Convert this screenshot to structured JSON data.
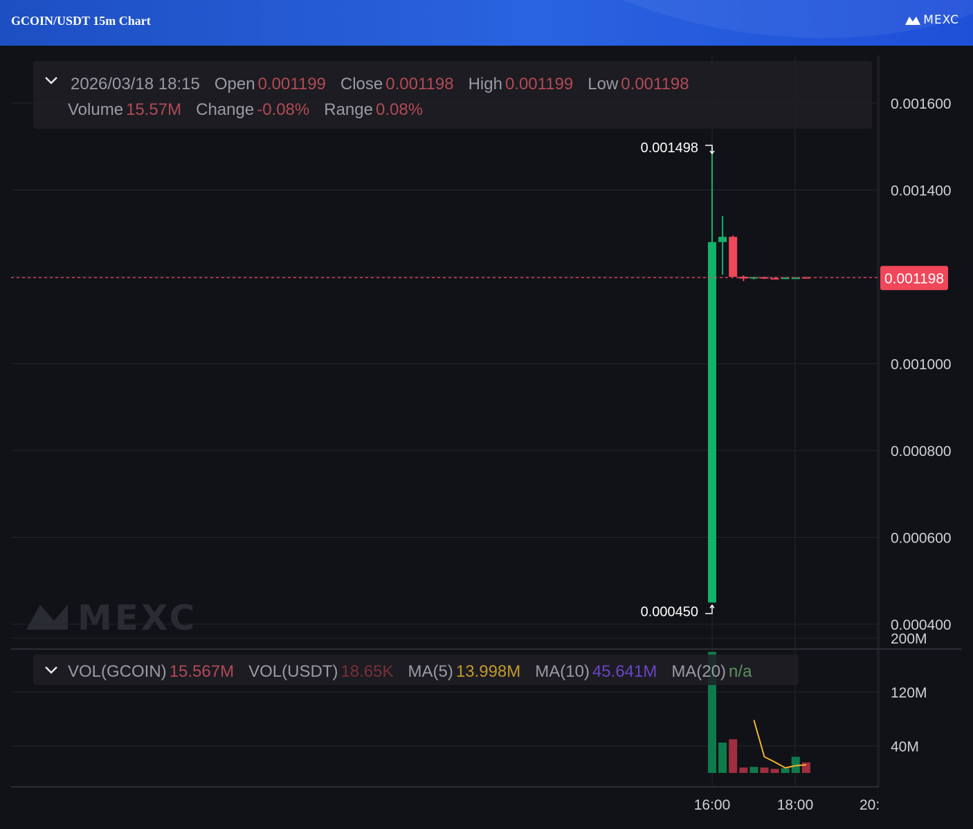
{
  "header": {
    "title": "GCOIN/USDT 15m Chart",
    "brand": "MEXC"
  },
  "watermark": "MEXC",
  "ohlc": {
    "datetime": "2026/03/18 18:15",
    "open_label": "Open",
    "open": "0.001199",
    "close_label": "Close",
    "close": "0.001198",
    "high_label": "High",
    "high": "0.001199",
    "low_label": "Low",
    "low": "0.001198",
    "volume_label": "Volume",
    "volume": "15.57M",
    "change_label": "Change",
    "change": "-0.08%",
    "range_label": "Range",
    "range": "0.08%"
  },
  "volume_legend": {
    "vol_gcoin_label": "VOL(GCOIN)",
    "vol_gcoin": "15.567M",
    "vol_usdt_label": "VOL(USDT)",
    "vol_usdt": "18.65K",
    "ma5_label": "MA(5)",
    "ma5": "13.998M",
    "ma10_label": "MA(10)",
    "ma10": "45.641M",
    "ma20_label": "MA(20)",
    "ma20": "n/a"
  },
  "colors": {
    "up": "#13b26b",
    "down": "#f0475b",
    "ma": "#f2b233",
    "grid": "#24262c"
  },
  "chart_data": {
    "type": "candlestick",
    "interval": "15m",
    "current_price": 0.001198,
    "current_price_label": "0.001198",
    "price_axis": {
      "ticks": [
        0.0016,
        0.0014,
        0.001,
        0.0008,
        0.0006,
        0.0004
      ],
      "tick_labels": [
        "0.001600",
        "0.001400",
        "0.001000",
        "0.000800",
        "0.000600",
        "0.000400"
      ],
      "range": [
        0.00039,
        0.00171
      ]
    },
    "volume_axis": {
      "tick_labels": [
        "200M",
        "120M",
        "40M"
      ],
      "ticks": [
        200,
        120,
        40
      ],
      "unit": "M"
    },
    "time_axis": {
      "tick_labels": [
        "16:00",
        "18:00",
        "20:"
      ]
    },
    "max_label": "0.001498",
    "min_label": "0.000450",
    "candles": [
      {
        "time": "16:00",
        "o": 0.00045,
        "h": 0.001498,
        "l": 0.00045,
        "c": 0.00128,
        "v": 280
      },
      {
        "time": "16:15",
        "o": 0.00128,
        "h": 0.00134,
        "l": 0.001205,
        "c": 0.001292,
        "v": 45
      },
      {
        "time": "16:30",
        "o": 0.001292,
        "h": 0.001295,
        "l": 0.0012,
        "c": 0.0012,
        "v": 50
      },
      {
        "time": "16:45",
        "o": 0.0012,
        "h": 0.001203,
        "l": 0.00119,
        "c": 0.001196,
        "v": 8
      },
      {
        "time": "17:00",
        "o": 0.001196,
        "h": 0.0012,
        "l": 0.001194,
        "c": 0.001199,
        "v": 9
      },
      {
        "time": "17:15",
        "o": 0.001199,
        "h": 0.0012,
        "l": 0.001195,
        "c": 0.001197,
        "v": 8
      },
      {
        "time": "17:30",
        "o": 0.001197,
        "h": 0.001199,
        "l": 0.001195,
        "c": 0.001196,
        "v": 6
      },
      {
        "time": "17:45",
        "o": 0.001196,
        "h": 0.001199,
        "l": 0.001195,
        "c": 0.001198,
        "v": 7
      },
      {
        "time": "18:00",
        "o": 0.001198,
        "h": 0.001199,
        "l": 0.001196,
        "c": 0.001198,
        "v": 24
      },
      {
        "time": "18:15",
        "o": 0.001199,
        "h": 0.001199,
        "l": 0.001198,
        "c": 0.001198,
        "v": 15.567
      }
    ],
    "ma5_line": [
      null,
      null,
      null,
      null,
      78.4,
      24,
      16.2,
      7.6,
      10.8,
      12
    ]
  }
}
